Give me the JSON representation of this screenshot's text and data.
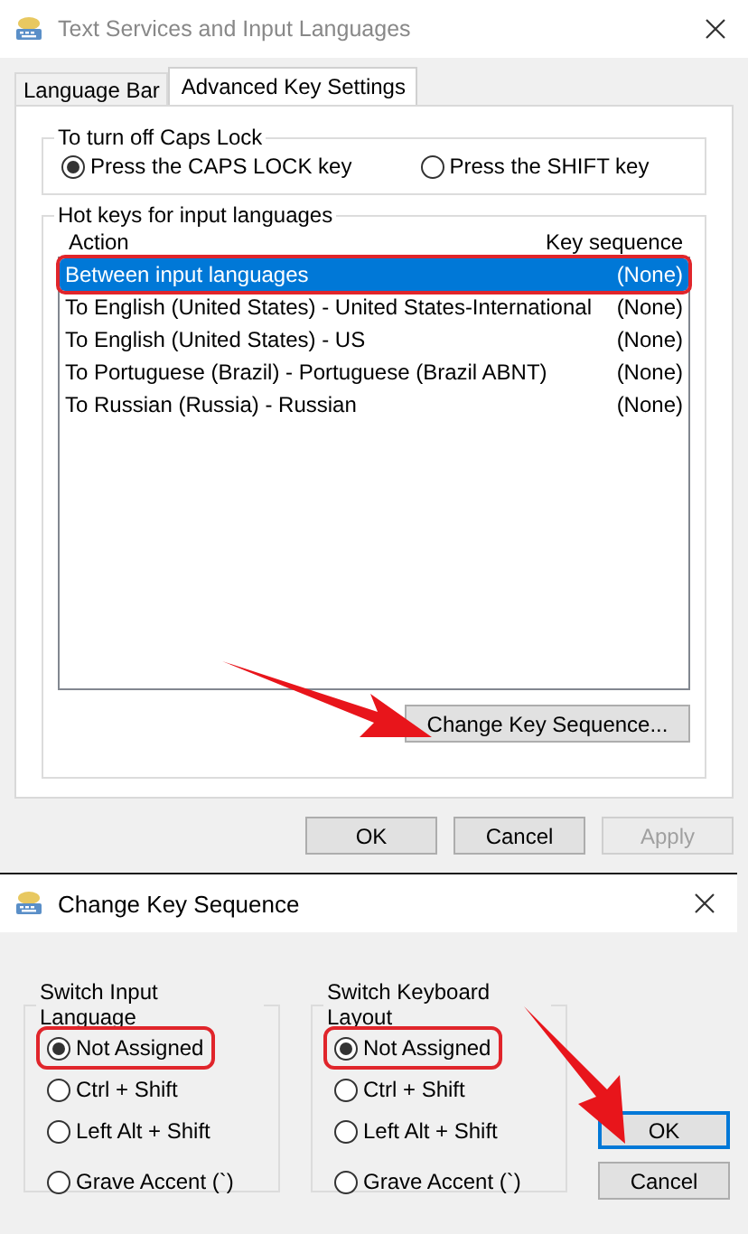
{
  "main_window": {
    "title": "Text Services and Input Languages",
    "tabs": [
      {
        "label": "Language Bar",
        "selected": false
      },
      {
        "label": "Advanced Key Settings",
        "selected": true
      }
    ],
    "caps_lock": {
      "title": "To turn off Caps Lock",
      "options": [
        {
          "label": "Press the CAPS LOCK key",
          "selected": true
        },
        {
          "label": "Press the SHIFT key",
          "selected": false
        }
      ]
    },
    "hot_keys": {
      "title": "Hot keys for input languages",
      "columns": [
        "Action",
        "Key sequence"
      ],
      "rows": [
        {
          "action": "Between input languages",
          "sequence": "(None)",
          "selected": true,
          "highlighted": true
        },
        {
          "action": "To English (United States) - United States-International",
          "sequence": "(None)",
          "selected": false,
          "highlighted": false
        },
        {
          "action": "To English (United States) - US",
          "sequence": "(None)",
          "selected": false,
          "highlighted": false
        },
        {
          "action": "To Portuguese (Brazil) - Portuguese (Brazil ABNT)",
          "sequence": "(None)",
          "selected": false,
          "highlighted": false
        },
        {
          "action": "To Russian (Russia) - Russian",
          "sequence": "(None)",
          "selected": false,
          "highlighted": false
        }
      ],
      "button": "Change Key Sequence..."
    },
    "buttons": [
      {
        "label": "OK",
        "disabled": false
      },
      {
        "label": "Cancel",
        "disabled": false
      },
      {
        "label": "Apply",
        "disabled": true
      }
    ]
  },
  "dialog": {
    "title": "Change Key Sequence",
    "groups": [
      {
        "title": "Switch Input Language",
        "options": [
          {
            "label": "Not Assigned",
            "selected": true,
            "highlighted": true
          },
          {
            "label": "Ctrl + Shift",
            "selected": false,
            "highlighted": false
          },
          {
            "label": "Left Alt + Shift",
            "selected": false,
            "highlighted": false
          },
          {
            "label": "Grave Accent (`)",
            "selected": false,
            "highlighted": false
          }
        ]
      },
      {
        "title": "Switch Keyboard Layout",
        "options": [
          {
            "label": "Not Assigned",
            "selected": true,
            "highlighted": true
          },
          {
            "label": "Ctrl + Shift",
            "selected": false,
            "highlighted": false
          },
          {
            "label": "Left Alt + Shift",
            "selected": false,
            "highlighted": false
          },
          {
            "label": "Grave Accent (`)",
            "selected": false,
            "highlighted": false
          }
        ]
      }
    ],
    "buttons": [
      {
        "label": "OK",
        "default": true
      },
      {
        "label": "Cancel",
        "default": false
      }
    ]
  }
}
